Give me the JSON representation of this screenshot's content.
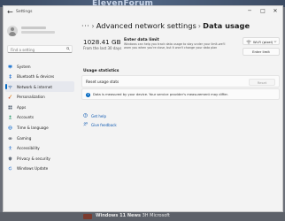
{
  "watermark": "ElevenForum",
  "window": {
    "title": "Settings",
    "controls": {
      "minimize": "─",
      "maximize": "□",
      "close": "✕"
    }
  },
  "sidebar": {
    "search_placeholder": "Find a setting",
    "items": [
      {
        "label": "System",
        "icon": "system-icon",
        "active": false
      },
      {
        "label": "Bluetooth & devices",
        "icon": "bluetooth-icon",
        "active": false
      },
      {
        "label": "Network & internet",
        "icon": "network-icon",
        "active": true
      },
      {
        "label": "Personalization",
        "icon": "brush-icon",
        "active": false
      },
      {
        "label": "Apps",
        "icon": "apps-icon",
        "active": false
      },
      {
        "label": "Accounts",
        "icon": "accounts-icon",
        "active": false
      },
      {
        "label": "Time & language",
        "icon": "globe-icon",
        "active": false
      },
      {
        "label": "Gaming",
        "icon": "gaming-icon",
        "active": false
      },
      {
        "label": "Accessibility",
        "icon": "accessibility-icon",
        "active": false
      },
      {
        "label": "Privacy & security",
        "icon": "shield-icon",
        "active": false
      },
      {
        "label": "Windows Update",
        "icon": "update-icon",
        "active": false
      }
    ]
  },
  "breadcrumb": {
    "ellipsis": "···",
    "parent": "Advanced network settings",
    "separator": "›",
    "current": "Data usage"
  },
  "usage": {
    "value": "1028.41 GB",
    "caption": "From the last 30 days"
  },
  "data_limit": {
    "title": "Enter data limit",
    "description": "Windows can help you track data usage to stay under your limit-we'll warn you when you're close, but it won't change your data plan",
    "network_select": "Wi-Fi (pixel)",
    "enter_limit_label": "Enter limit"
  },
  "usage_statistics": {
    "title": "Usage statistics",
    "reset_label": "Reset usage stats",
    "reset_button": "Reset",
    "info_text": "Data is measured by your device. Your service provider's measurement may differ."
  },
  "links": {
    "help": "Get help",
    "feedback": "Give feedback"
  },
  "taskbar": {
    "news_bold": "Windows 11 News",
    "news_rest": "3H Microsoft"
  },
  "colors": {
    "accent": "#0067c0",
    "link": "#0b57b0",
    "window_bg": "#f3f3f3"
  }
}
